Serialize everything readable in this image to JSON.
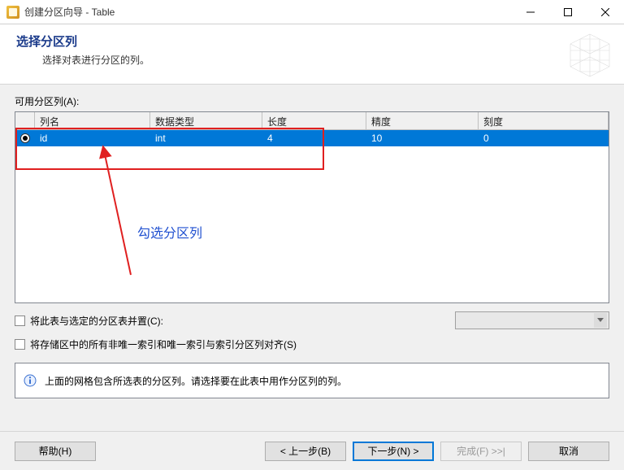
{
  "window": {
    "title": "创建分区向导 - Table"
  },
  "header": {
    "title": "选择分区列",
    "subtitle": "选择对表进行分区的列。"
  },
  "grid": {
    "label": "可用分区列(A):",
    "columns": {
      "c0": "列名",
      "c1": "数据类型",
      "c2": "长度",
      "c3": "精度",
      "c4": "刻度"
    },
    "rows": [
      {
        "selected": true,
        "name": "id",
        "type": "int",
        "length": "4",
        "precision": "10",
        "scale": "0"
      }
    ]
  },
  "options": {
    "collocate_label": "将此表与选定的分区表并置(C):",
    "align_indexes_label": "将存储区中的所有非唯一索引和唯一索引与索引分区列对齐(S)"
  },
  "info": {
    "text": "上面的网格包含所选表的分区列。请选择要在此表中用作分区列的列。"
  },
  "annotation": {
    "text": "勾选分区列"
  },
  "buttons": {
    "help": "帮助(H)",
    "back": "< 上一步(B)",
    "next": "下一步(N) >",
    "finish": "完成(F) >>|",
    "cancel": "取消"
  }
}
